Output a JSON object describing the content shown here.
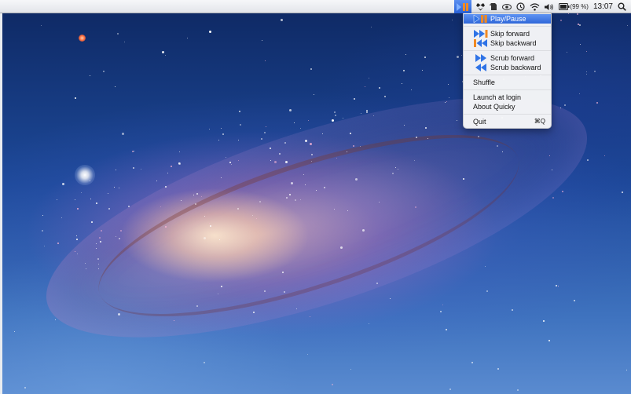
{
  "menubar": {
    "battery": "(99 %)",
    "clock": "13:07"
  },
  "menu": {
    "play_pause": "Play/Pause",
    "skip_forward": "Skip forward",
    "skip_backward": "Skip backward",
    "scrub_forward": "Scrub forward",
    "scrub_backward": "Scrub backward",
    "shuffle": "Shuffle",
    "launch_at_login": "Launch at login",
    "about": "About Quicky",
    "quit": "Quit",
    "quit_shortcut": "⌘Q"
  },
  "colors": {
    "highlight": "#2f66d9",
    "icon_blue": "#2f73e6",
    "icon_orange": "#f08a24"
  }
}
